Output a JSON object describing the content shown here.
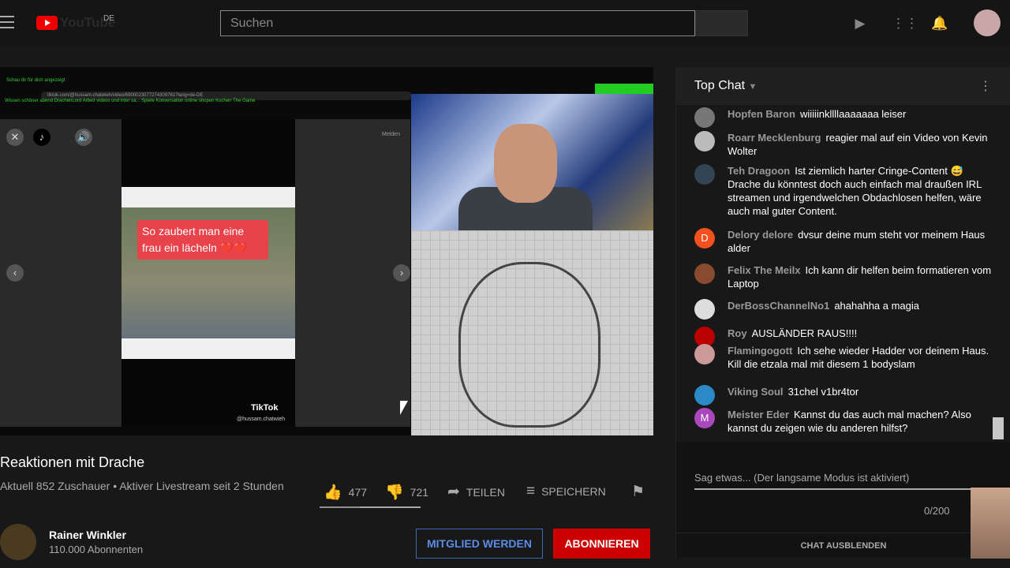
{
  "header": {
    "logo_text": "YouTube",
    "country": "DE",
    "search_placeholder": "Suchen"
  },
  "video": {
    "browser_tab": "Schau dir für dich angezeigt",
    "url": "tiktok.com/@hussam.chatwieh/video/6900023077274309761?lang=de-DE",
    "bookmarks": "Wissen   schöner abend   DrachenLord Arbeit   videos und inter sa...   Spiele   Konversation   online shopen   Kochen   The Game",
    "caption": "So zaubert man eine frau ein lächeln ❤️❤️",
    "tiktok_label": "TikTok",
    "tiktok_user": "@hussam.chatwieh",
    "report": "Melden"
  },
  "info": {
    "title": "Reaktionen mit Drache",
    "meta": "Aktuell 852 Zuschauer • Aktiver Livestream seit 2 Stunden",
    "likes": "477",
    "dislikes": "721",
    "like_ratio": 0.4,
    "share": "TEILEN",
    "save": "SPEICHERN"
  },
  "channel": {
    "name": "Rainer Winkler",
    "subscribers": "110.000 Abonnenten",
    "member_button": "MITGLIED WERDEN",
    "subscribe_button": "ABONNIEREN"
  },
  "chat": {
    "title": "Top Chat",
    "messages": [
      {
        "author": "Hopfen Baron",
        "text": "wiiiiinkllllaaaaaaa leiser",
        "avatar": "#777"
      },
      {
        "author": "Roarr Mecklenburg",
        "text": "reagier mal auf ein Video von Kevin Wolter",
        "avatar": "#bbb"
      },
      {
        "author": "Teh Dragoon",
        "text": "Ist ziemlich harter Cringe-Content 😅 Drache du könntest doch auch einfach mal draußen IRL streamen und irgendwelchen Obdachlosen helfen, wäre auch mal guter Content.",
        "avatar": "#345"
      },
      {
        "author": "Delory delore",
        "text": "dvsur deine mum steht vor meinem Haus alder",
        "avatar": "#f4511e",
        "initial": "D"
      },
      {
        "author": "Felix The Meilx",
        "text": "Ich kann dir helfen beim formatieren vom Laptop",
        "avatar": "#8a4a30"
      },
      {
        "author": "DerBossChannelNo1",
        "text": "ahahahha a magia",
        "avatar": "#ddd"
      },
      {
        "author": "Roy",
        "text": "AUSLÄNDER RAUS!!!!",
        "avatar": "#b00"
      },
      {
        "author": "Flamingogott",
        "text": "Ich sehe wieder Hadder vor deinem Haus. Kill die etzala mal mit diesem 1 bodyslam",
        "avatar": "#c99"
      },
      {
        "author": "Viking Soul",
        "text": "31chel v1br4tor",
        "avatar": "#2a8ac8"
      },
      {
        "author": "Meister Eder",
        "text": "Kannst du das auch mal machen? Also kannst du zeigen wie du anderen hilfst?",
        "avatar": "#ab47bc",
        "initial": "M"
      }
    ],
    "input_placeholder": "Sag etwas... (Der langsame Modus ist aktiviert)",
    "char_count": "0/200",
    "hide_button": "CHAT AUSBLENDEN"
  }
}
